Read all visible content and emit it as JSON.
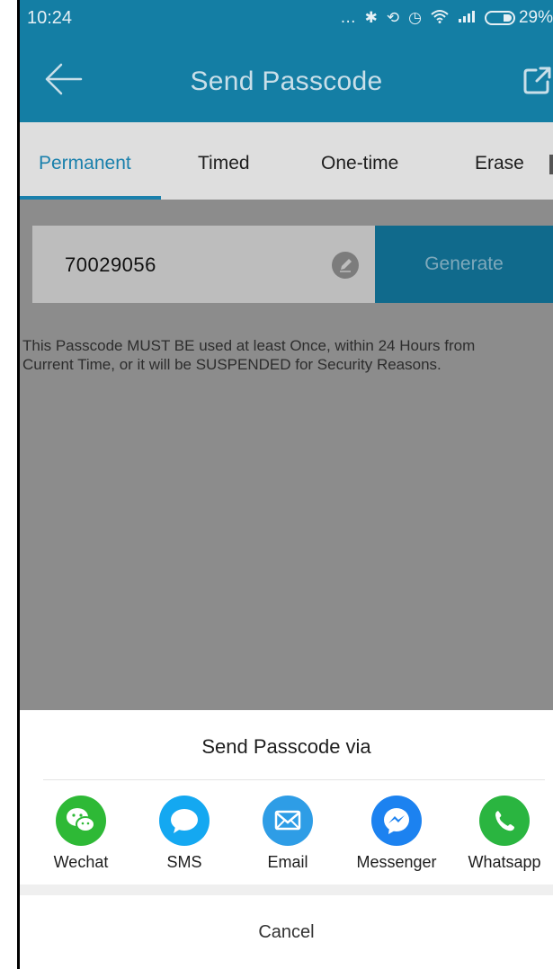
{
  "status_bar": {
    "time": "10:24",
    "battery_percent": "29%",
    "icons": [
      "more-dots-icon",
      "bluetooth-icon",
      "sync-icon",
      "alarm-icon",
      "wifi-icon",
      "signal-icon",
      "battery-icon"
    ]
  },
  "app_bar": {
    "title": "Send Passcode",
    "color": "#147ea4"
  },
  "tabs": {
    "items": [
      {
        "label": "Permanent",
        "active": true
      },
      {
        "label": "Timed",
        "active": false
      },
      {
        "label": "One-time",
        "active": false
      },
      {
        "label": "Erase",
        "active": false
      }
    ],
    "accent": "#1a80ac"
  },
  "passcode": {
    "value": "70029056",
    "generate_label": "Generate",
    "notice": "This Passcode MUST BE used at least Once, within 24 Hours from Current Time, or it will be SUSPENDED for Security Reasons."
  },
  "share_sheet": {
    "title": "Send Passcode via",
    "options": [
      {
        "label": "Wechat",
        "icon": "wechat-icon",
        "color": "#2eb936"
      },
      {
        "label": "SMS",
        "icon": "sms-icon",
        "color": "#14a8f1"
      },
      {
        "label": "Email",
        "icon": "email-icon",
        "color": "#2e9de6"
      },
      {
        "label": "Messenger",
        "icon": "messenger-icon",
        "color": "#1c82f0"
      },
      {
        "label": "Whatsapp",
        "icon": "whatsapp-icon",
        "color": "#2ab540"
      }
    ],
    "cancel_label": "Cancel"
  }
}
